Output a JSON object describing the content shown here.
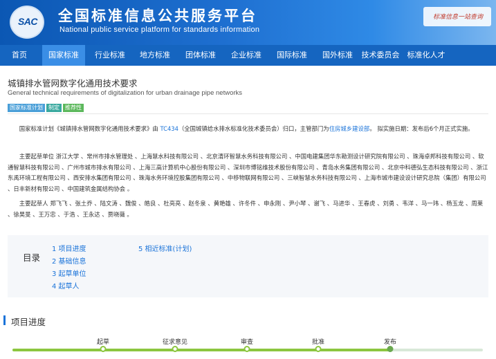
{
  "header": {
    "logo_text": "SAC",
    "title": "全国标准信息公共服务平台",
    "subtitle": "National public service platform  for standards information",
    "slogan": "标准信息一站查询"
  },
  "nav": {
    "items": [
      "首页",
      "国家标准",
      "行业标准",
      "地方标准",
      "团体标准",
      "企业标准",
      "国际标准",
      "国外标准",
      "技术委员会",
      "标准化人才"
    ],
    "active_index": 1
  },
  "document": {
    "title": "城镇排水管网数字化通用技术要求",
    "subtitle_en": "General technical requirements of digitalization for urban drainage pipe networks",
    "badges": [
      "国家标准计划",
      "制定",
      "推荐性"
    ]
  },
  "overview": {
    "part1": "国家标准计划《城镇排水管网数字化通用技术要求》由 ",
    "tc_link": "TC434",
    "part2": "（全国城镇给水排水标准化技术委员会）归口，主管部门为",
    "dept_link": "住房城乡建设部",
    "part3": "。  拟实施日期：发布后6个月正式实施。"
  },
  "drafting_units": {
    "text": "主要起草单位 浙江大学 、常州市排水管理处 、上海慧水科技有限公司 、北京清环智慧水务科技有限公司 、中国电建集团华东勘测设计研究院有限公司 、珠海卓邦科技有限公司 、软通智慧科技有限公司 、广州市城市排水有限公司 、上海三高计算机中心股份有限公司 、深圳市博铭维技术股份有限公司 、青岛水务集团有限公司 、北京中科德弘生态科技有限公司 、浙江东禹环境工程有限公司 、西安排水集团有限公司 、珠海水务环境控股集团有限公司 、中移物联网有限公司 、三峡智慧水务科技有限公司 、上海市城市建设设计研究总院（集团）有限公司 、日丰新材有限公司 、中国建筑金属结构协会 。"
  },
  "drafters": {
    "text": "主要起草人 郑飞飞 、张土乔 、陆文涛 、魏俊 、皓良 、杜亮亮 、赵冬泉 、黄艳雄 、许冬件 、申永刚 、尹小琴 、谢飞 、马进华 、王春虎 、刘勇 、韦洋 、马一玮 、杨玉龙 、周莱 、徐昊旻 、王万忠 、于浩 、王永达 、贾晓薇 。"
  },
  "toc": {
    "label": "目录",
    "items": [
      "1  项目进度",
      "2  基础信息",
      "3  起草单位",
      "4  起草人",
      "5  相近标准(计划)"
    ]
  },
  "progress": {
    "title": "项目进度",
    "steps": [
      "起草",
      "征求意见",
      "审查",
      "批准",
      "发布"
    ],
    "current_step": "发布"
  },
  "colors": {
    "header_blue": "#0b57b3",
    "nav_blue": "#1565c0",
    "nav_active": "#3a8ee6",
    "link_blue": "#1a73d9",
    "progress_green": "#8cc63f"
  }
}
